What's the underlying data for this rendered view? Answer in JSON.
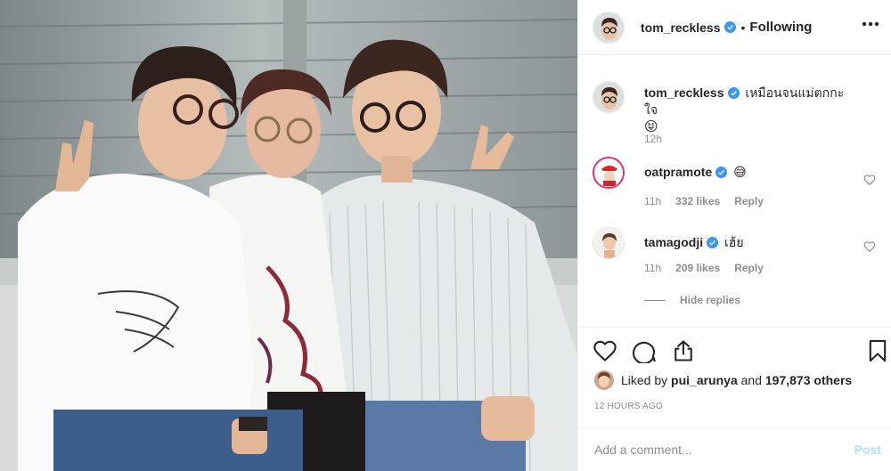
{
  "post": {
    "image_alt": "Three people smiling and posing together; two making peace signs",
    "author": {
      "username": "tom_reckless",
      "verified": true,
      "follow_status": "Following",
      "separator": "•"
    },
    "menu_icon": "more-horizontal-icon"
  },
  "comments": [
    {
      "username": "tom_reckless",
      "verified": true,
      "text": "เหมือนจนแม่ตกกะใจ",
      "emoji": "😝",
      "time": "12h",
      "likes": "",
      "reply_label": ""
    },
    {
      "username": "oatpramote",
      "verified": true,
      "text": "",
      "emoji": "😅",
      "time": "11h",
      "likes": "332 likes",
      "reply_label": "Reply"
    },
    {
      "username": "tamagodji",
      "verified": true,
      "text": "เฮ้ย",
      "emoji": "",
      "time": "11h",
      "likes": "209 likes",
      "reply_label": "Reply"
    }
  ],
  "hide_replies_label": "Hide replies",
  "actions": {
    "like_icon": "heart-icon",
    "comment_icon": "comment-icon",
    "share_icon": "share-icon",
    "save_icon": "bookmark-icon"
  },
  "likes": {
    "prefix": "Liked by",
    "first_user": "pui_arunya",
    "connector": "and",
    "others": "197,873 others"
  },
  "timestamp": "12 HOURS AGO",
  "add_comment": {
    "placeholder": "Add a comment...",
    "post_label": "Post"
  },
  "colors": {
    "verified_blue": "#3897f0",
    "muted_text": "#8e8e8e",
    "post_disabled": "#b2dffc",
    "border": "#efefef"
  }
}
